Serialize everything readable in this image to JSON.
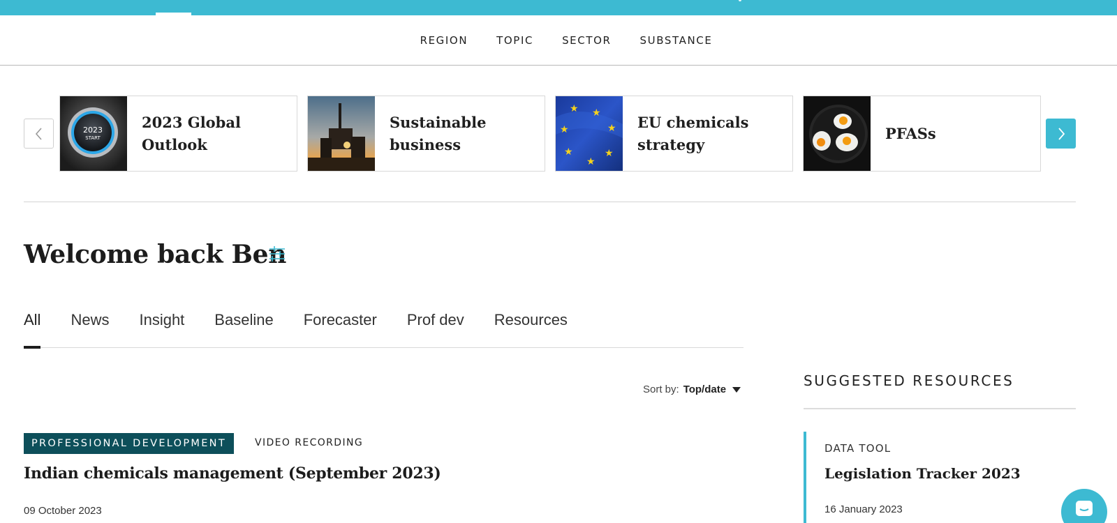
{
  "colors": {
    "brand": "#3dbad2",
    "badge": "#0d4f5a",
    "text": "#1c1c1c",
    "divider": "#d4d4d4"
  },
  "main_nav": {
    "items": [
      {
        "label": "REGION"
      },
      {
        "label": "TOPIC"
      },
      {
        "label": "SECTOR"
      },
      {
        "label": "SUBSTANCE"
      }
    ]
  },
  "carousel": {
    "prev_icon": "chevron-left-icon",
    "next_icon": "chevron-right-icon",
    "cards": [
      {
        "label_line1": "2023 Global",
        "label_line2": "Outlook",
        "image_text_1": "2023",
        "image_text_2": "START"
      },
      {
        "label_line1": "Sustainable",
        "label_line2": "business"
      },
      {
        "label_line1": "EU chemicals",
        "label_line2": "strategy"
      },
      {
        "label_line1": "PFASs",
        "label_line2": ""
      }
    ]
  },
  "welcome": {
    "title": "Welcome back Ben",
    "filter_icon": "sliders-icon"
  },
  "tabs": [
    {
      "label": "All",
      "active": true
    },
    {
      "label": "News"
    },
    {
      "label": "Insight"
    },
    {
      "label": "Baseline"
    },
    {
      "label": "Forecaster"
    },
    {
      "label": "Prof dev"
    },
    {
      "label": "Resources"
    }
  ],
  "sort": {
    "label": "Sort by:",
    "value": "Top/date"
  },
  "feed": {
    "items": [
      {
        "badge": "PROFESSIONAL DEVELOPMENT",
        "type": "VIDEO RECORDING",
        "title": "Indian chemicals management (September 2023)",
        "date": "09 October 2023"
      }
    ]
  },
  "sidebar": {
    "heading": "SUGGESTED RESOURCES",
    "items": [
      {
        "type": "DATA TOOL",
        "title": "Legislation Tracker 2023",
        "date": "16 January 2023"
      }
    ]
  },
  "chat": {
    "icon": "chat-bubble-icon"
  }
}
